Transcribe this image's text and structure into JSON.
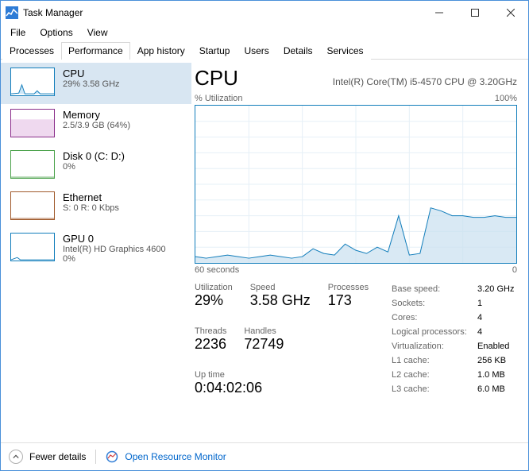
{
  "window": {
    "title": "Task Manager"
  },
  "menu": {
    "file": "File",
    "options": "Options",
    "view": "View"
  },
  "tabs": {
    "processes": "Processes",
    "performance": "Performance",
    "app_history": "App history",
    "startup": "Startup",
    "users": "Users",
    "details": "Details",
    "services": "Services"
  },
  "sidebar": {
    "cpu": {
      "title": "CPU",
      "sub": "29% 3.58 GHz",
      "color": "#117dbb"
    },
    "memory": {
      "title": "Memory",
      "sub": "2.5/3.9 GB (64%)",
      "color": "#8b2e8b"
    },
    "disk": {
      "title": "Disk 0 (C: D:)",
      "sub": "0%",
      "color": "#4ca24c"
    },
    "eth": {
      "title": "Ethernet",
      "sub": "S: 0  R: 0 Kbps",
      "color": "#a05a2c"
    },
    "gpu": {
      "title": "GPU 0",
      "sub": "Intel(R) HD Graphics 4600",
      "sub2": "0%",
      "color": "#117dbb"
    }
  },
  "detail": {
    "title": "CPU",
    "device": "Intel(R) Core(TM) i5-4570 CPU @ 3.20GHz",
    "chart_top_left": "% Utilization",
    "chart_top_right": "100%",
    "chart_bot_left": "60 seconds",
    "chart_bot_right": "0",
    "stat_util_label": "Utilization",
    "stat_util_value": "29%",
    "stat_speed_label": "Speed",
    "stat_speed_value": "3.58 GHz",
    "stat_proc_label": "Processes",
    "stat_proc_value": "173",
    "stat_threads_label": "Threads",
    "stat_threads_value": "2236",
    "stat_handles_label": "Handles",
    "stat_handles_value": "72749",
    "stat_uptime_label": "Up time",
    "stat_uptime_value": "0:04:02:06",
    "kv_base_speed_k": "Base speed:",
    "kv_base_speed_v": "3.20 GHz",
    "kv_sockets_k": "Sockets:",
    "kv_sockets_v": "1",
    "kv_cores_k": "Cores:",
    "kv_cores_v": "4",
    "kv_logical_k": "Logical processors:",
    "kv_logical_v": "4",
    "kv_virt_k": "Virtualization:",
    "kv_virt_v": "Enabled",
    "kv_l1_k": "L1 cache:",
    "kv_l1_v": "256 KB",
    "kv_l2_k": "L2 cache:",
    "kv_l2_v": "1.0 MB",
    "kv_l3_k": "L3 cache:",
    "kv_l3_v": "6.0 MB"
  },
  "footer": {
    "fewer": "Fewer details",
    "open_rm": "Open Resource Monitor"
  },
  "chart_data": {
    "type": "area",
    "title": "% Utilization",
    "xlabel": "60 seconds",
    "ylabel": "% Utilization",
    "ylim": [
      0,
      100
    ],
    "x_seconds_ago": [
      60,
      58,
      56,
      54,
      52,
      50,
      48,
      46,
      44,
      42,
      40,
      38,
      36,
      34,
      32,
      30,
      28,
      26,
      24,
      22,
      20,
      18,
      16,
      14,
      12,
      10,
      8,
      6,
      4,
      2,
      0
    ],
    "values": [
      4,
      3,
      4,
      5,
      4,
      3,
      4,
      5,
      4,
      3,
      4,
      9,
      6,
      5,
      12,
      8,
      6,
      10,
      7,
      30,
      5,
      6,
      35,
      33,
      30,
      30,
      29,
      29,
      30,
      29,
      29
    ]
  }
}
